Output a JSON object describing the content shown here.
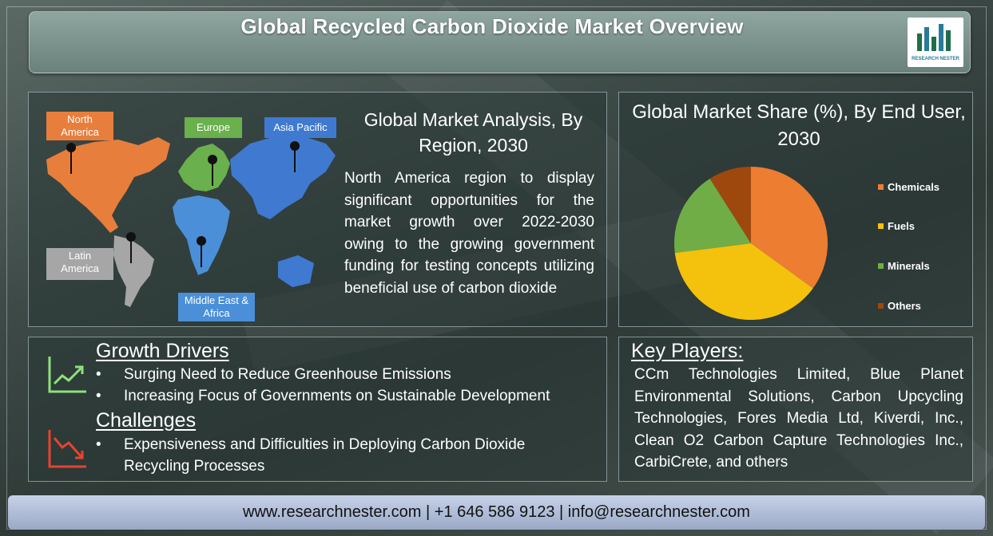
{
  "header": {
    "title": "Global Recycled Carbon Dioxide Market Overview"
  },
  "logo": {
    "text": "RESEARCH NESTER"
  },
  "region_panel": {
    "title": "Global Market Analysis, By Region, 2030",
    "description": "North America region to display significant opportunities for the market growth over 2022-2030 owing to the growing government funding for testing concepts utilizing beneficial use of carbon dioxide",
    "regions": [
      {
        "label": "North America",
        "color": "#e87e3c"
      },
      {
        "label": "Europe",
        "color": "#6ab04c"
      },
      {
        "label": "Asia Pacific",
        "color": "#3f7ad0"
      },
      {
        "label": "Latin America",
        "color": "#a6a6a6"
      },
      {
        "label": "Middle East & Africa",
        "color": "#4a8fd8"
      }
    ]
  },
  "chart_data": {
    "type": "pie",
    "title": "Global Market Share (%), By End User, 2030",
    "categories": [
      "Chemicals",
      "Fuels",
      "Minerals",
      "Others"
    ],
    "values": [
      35,
      38,
      18,
      9
    ],
    "colors": [
      "#ed7d31",
      "#f4c20d",
      "#70ad47",
      "#9e480e"
    ],
    "legend": "right"
  },
  "growth_drivers": {
    "heading": "Growth Drivers",
    "items": [
      "Surging Need to Reduce Greenhouse Emissions",
      "Increasing Focus of Governments on Sustainable Development"
    ]
  },
  "challenges": {
    "heading": "Challenges",
    "items": [
      "Expensiveness and Difficulties in Deploying Carbon Dioxide Recycling Processes"
    ]
  },
  "key_players": {
    "heading": "Key Players:",
    "text": "CCm Technologies Limited, Blue Planet Environmental Solutions, Carbon Upcycling Technologies, Fores Media Ltd, Kiverdi, Inc., Clean O2 Carbon Capture Technologies Inc., CarbiCrete, and others"
  },
  "footer": {
    "text": "www.researchnester.com | +1 646 586 9123 | info@researchnester.com"
  },
  "bullet_char": "•"
}
